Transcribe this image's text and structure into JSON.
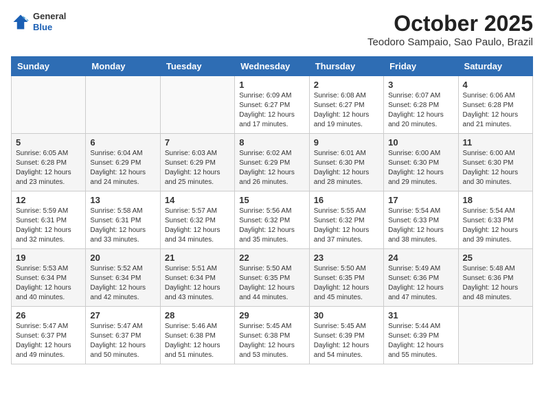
{
  "header": {
    "logo_general": "General",
    "logo_blue": "Blue",
    "month_title": "October 2025",
    "location": "Teodoro Sampaio, Sao Paulo, Brazil"
  },
  "weekdays": [
    "Sunday",
    "Monday",
    "Tuesday",
    "Wednesday",
    "Thursday",
    "Friday",
    "Saturday"
  ],
  "weeks": [
    [
      {
        "day": "",
        "info": ""
      },
      {
        "day": "",
        "info": ""
      },
      {
        "day": "",
        "info": ""
      },
      {
        "day": "1",
        "info": "Sunrise: 6:09 AM\nSunset: 6:27 PM\nDaylight: 12 hours\nand 17 minutes."
      },
      {
        "day": "2",
        "info": "Sunrise: 6:08 AM\nSunset: 6:27 PM\nDaylight: 12 hours\nand 19 minutes."
      },
      {
        "day": "3",
        "info": "Sunrise: 6:07 AM\nSunset: 6:28 PM\nDaylight: 12 hours\nand 20 minutes."
      },
      {
        "day": "4",
        "info": "Sunrise: 6:06 AM\nSunset: 6:28 PM\nDaylight: 12 hours\nand 21 minutes."
      }
    ],
    [
      {
        "day": "5",
        "info": "Sunrise: 6:05 AM\nSunset: 6:28 PM\nDaylight: 12 hours\nand 23 minutes."
      },
      {
        "day": "6",
        "info": "Sunrise: 6:04 AM\nSunset: 6:29 PM\nDaylight: 12 hours\nand 24 minutes."
      },
      {
        "day": "7",
        "info": "Sunrise: 6:03 AM\nSunset: 6:29 PM\nDaylight: 12 hours\nand 25 minutes."
      },
      {
        "day": "8",
        "info": "Sunrise: 6:02 AM\nSunset: 6:29 PM\nDaylight: 12 hours\nand 26 minutes."
      },
      {
        "day": "9",
        "info": "Sunrise: 6:01 AM\nSunset: 6:30 PM\nDaylight: 12 hours\nand 28 minutes."
      },
      {
        "day": "10",
        "info": "Sunrise: 6:00 AM\nSunset: 6:30 PM\nDaylight: 12 hours\nand 29 minutes."
      },
      {
        "day": "11",
        "info": "Sunrise: 6:00 AM\nSunset: 6:30 PM\nDaylight: 12 hours\nand 30 minutes."
      }
    ],
    [
      {
        "day": "12",
        "info": "Sunrise: 5:59 AM\nSunset: 6:31 PM\nDaylight: 12 hours\nand 32 minutes."
      },
      {
        "day": "13",
        "info": "Sunrise: 5:58 AM\nSunset: 6:31 PM\nDaylight: 12 hours\nand 33 minutes."
      },
      {
        "day": "14",
        "info": "Sunrise: 5:57 AM\nSunset: 6:32 PM\nDaylight: 12 hours\nand 34 minutes."
      },
      {
        "day": "15",
        "info": "Sunrise: 5:56 AM\nSunset: 6:32 PM\nDaylight: 12 hours\nand 35 minutes."
      },
      {
        "day": "16",
        "info": "Sunrise: 5:55 AM\nSunset: 6:32 PM\nDaylight: 12 hours\nand 37 minutes."
      },
      {
        "day": "17",
        "info": "Sunrise: 5:54 AM\nSunset: 6:33 PM\nDaylight: 12 hours\nand 38 minutes."
      },
      {
        "day": "18",
        "info": "Sunrise: 5:54 AM\nSunset: 6:33 PM\nDaylight: 12 hours\nand 39 minutes."
      }
    ],
    [
      {
        "day": "19",
        "info": "Sunrise: 5:53 AM\nSunset: 6:34 PM\nDaylight: 12 hours\nand 40 minutes."
      },
      {
        "day": "20",
        "info": "Sunrise: 5:52 AM\nSunset: 6:34 PM\nDaylight: 12 hours\nand 42 minutes."
      },
      {
        "day": "21",
        "info": "Sunrise: 5:51 AM\nSunset: 6:34 PM\nDaylight: 12 hours\nand 43 minutes."
      },
      {
        "day": "22",
        "info": "Sunrise: 5:50 AM\nSunset: 6:35 PM\nDaylight: 12 hours\nand 44 minutes."
      },
      {
        "day": "23",
        "info": "Sunrise: 5:50 AM\nSunset: 6:35 PM\nDaylight: 12 hours\nand 45 minutes."
      },
      {
        "day": "24",
        "info": "Sunrise: 5:49 AM\nSunset: 6:36 PM\nDaylight: 12 hours\nand 47 minutes."
      },
      {
        "day": "25",
        "info": "Sunrise: 5:48 AM\nSunset: 6:36 PM\nDaylight: 12 hours\nand 48 minutes."
      }
    ],
    [
      {
        "day": "26",
        "info": "Sunrise: 5:47 AM\nSunset: 6:37 PM\nDaylight: 12 hours\nand 49 minutes."
      },
      {
        "day": "27",
        "info": "Sunrise: 5:47 AM\nSunset: 6:37 PM\nDaylight: 12 hours\nand 50 minutes."
      },
      {
        "day": "28",
        "info": "Sunrise: 5:46 AM\nSunset: 6:38 PM\nDaylight: 12 hours\nand 51 minutes."
      },
      {
        "day": "29",
        "info": "Sunrise: 5:45 AM\nSunset: 6:38 PM\nDaylight: 12 hours\nand 53 minutes."
      },
      {
        "day": "30",
        "info": "Sunrise: 5:45 AM\nSunset: 6:39 PM\nDaylight: 12 hours\nand 54 minutes."
      },
      {
        "day": "31",
        "info": "Sunrise: 5:44 AM\nSunset: 6:39 PM\nDaylight: 12 hours\nand 55 minutes."
      },
      {
        "day": "",
        "info": ""
      }
    ]
  ]
}
